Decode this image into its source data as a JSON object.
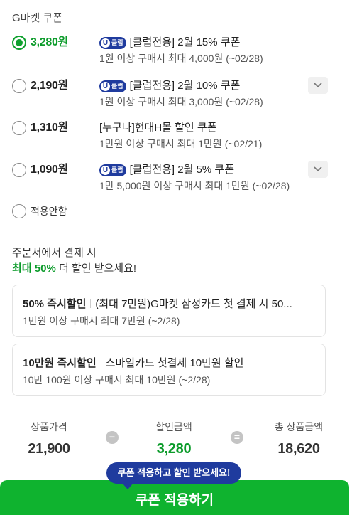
{
  "section_title": "G마켓 쿠폰",
  "coupons": [
    {
      "price": "3,280원",
      "badge": "클럽",
      "name": "[클럽전용] 2월 15% 쿠폰",
      "desc": "1원 이상 구매시 최대 4,000원 (~02/28)",
      "selected": true
    },
    {
      "price": "2,190원",
      "badge": "클럽",
      "name": "[클럽전용] 2월 10% 쿠폰",
      "desc": "1원 이상 구매시 최대 3,000원 (~02/28)",
      "selected": false
    },
    {
      "price": "1,310원",
      "name": "[누구나]현대H몰 할인 쿠폰",
      "desc": "1만원 이상 구매시 최대 1만원 (~02/21)",
      "selected": false
    },
    {
      "price": "1,090원",
      "badge": "클럽",
      "name": "[클럽전용] 2월 5% 쿠폰",
      "desc": "1만 5,000원 이상 구매시 최대 1만원 (~02/28)",
      "selected": false
    }
  ],
  "no_apply_label": "적용안함",
  "promo": {
    "line1": "주문서에서 결제 시",
    "highlight": "최대 50%",
    "line2_rest": " 더 할인 받으세요!"
  },
  "card_offers": [
    {
      "title": "50% 즉시할인",
      "detail": "(최대 7만원)G마켓 삼성카드 첫 결제 시 50...",
      "desc": "1만원 이상 구매시 최대 7만원 (~2/28)"
    },
    {
      "title": "10만원 즉시할인",
      "detail": "스마일카드 첫결제 10만원 할인",
      "desc": "10만 100원 이상 구매시 최대 10만원 (~2/28)"
    }
  ],
  "summary": {
    "product_price_label": "상품가격",
    "product_price": "21,900",
    "discount_label": "할인금액",
    "discount": "3,280",
    "total_label": "총 상품금액",
    "total": "18,620",
    "minus_symbol": "−",
    "equals_symbol": "="
  },
  "tooltip": "쿠폰 적용하고 할인 받으세요!",
  "apply_button": "쿠폰 적용하기",
  "colors": {
    "accent_green": "#0fb32f",
    "club_blue": "#1f3b9e"
  },
  "icons": {
    "club_badge": "u-club-icon",
    "expand": "chevron-down-icon"
  }
}
